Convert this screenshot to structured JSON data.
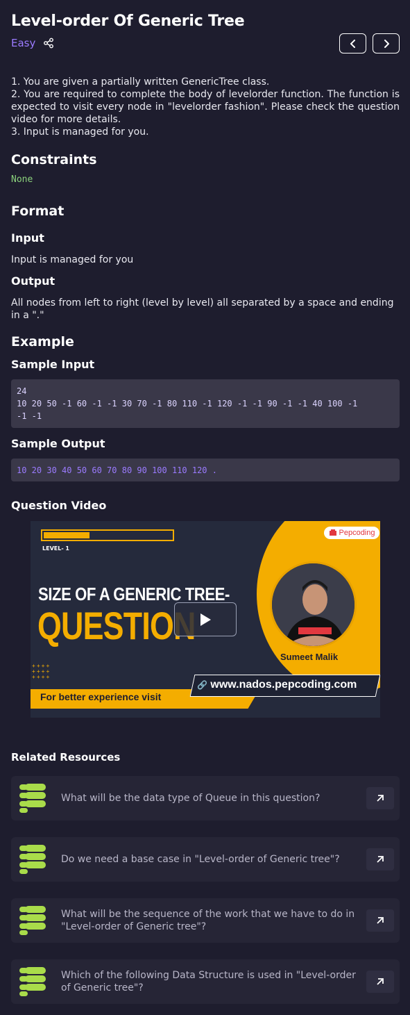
{
  "header": {
    "title": "Level-order Of Generic Tree",
    "difficulty": "Easy"
  },
  "description": {
    "lines": [
      "1. You are given a partially written GenericTree class.",
      "2. You are required to complete the body of levelorder function. The function is expected to visit every node in \"levelorder fashion\". Please check the question video for more details.",
      "3. Input is managed for you."
    ]
  },
  "constraints": {
    "heading": "Constraints",
    "value": "None"
  },
  "format": {
    "heading": "Format",
    "input_heading": "Input",
    "input_text": "Input is managed for you",
    "output_heading": "Output",
    "output_text": "All nodes from left to right (level by level) all separated by a space and ending in a \".\""
  },
  "example": {
    "heading": "Example",
    "sample_input_heading": "Sample Input",
    "sample_input_line1": "24",
    "sample_input_line2": "10 20 50 -1 60 -1 -1 30 70 -1 80 110 -1 120 -1 -1 90 -1 -1 40 100 -1",
    "sample_input_line3": "-1 -1",
    "sample_output_heading": "Sample Output",
    "sample_output": "10 20 30 40 50 60 70 80 90 100 110 120 ."
  },
  "video": {
    "heading": "Question Video",
    "level": "LEVEL- 1",
    "progress": 0.35,
    "headline": "SIZE OF A GENERIC TREE-",
    "headline2": "QUESTION",
    "brand": "Pepcoding",
    "presenter": "Sumeet Malik",
    "url": "www.nados.pepcoding.com",
    "cta": "For better experience visit",
    "accent": "#f4ad00"
  },
  "related": {
    "heading": "Related Resources",
    "items": [
      {
        "text": "What will be the data type of Queue in this question?"
      },
      {
        "text": "Do we need a base case in \"Level-order of Generic tree\"?"
      },
      {
        "text": "What will be the sequence of the work that we have to do in \"Level-order of Generic tree\"?"
      },
      {
        "text": "Which of the following Data Structure is used in \"Level-order of Generic tree\"?"
      }
    ]
  },
  "colors": {
    "background": "#1e1d2e",
    "accent": "#9b7bff",
    "constraint_green": "#8bd17c",
    "resource_icon_green": "#a9dc4a"
  }
}
